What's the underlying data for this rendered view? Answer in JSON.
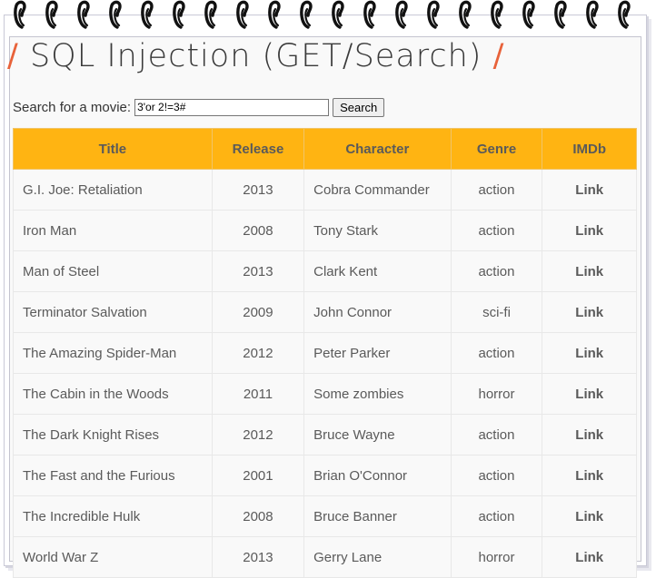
{
  "page": {
    "title_prefix": "/",
    "title_text": "SQL Injection (GET/Search)",
    "title_suffix": "/"
  },
  "search": {
    "label": "Search for a movie:",
    "value": "3'or 2!=3#",
    "button_label": "Search"
  },
  "table": {
    "headers": [
      "Title",
      "Release",
      "Character",
      "Genre",
      "IMDb"
    ],
    "rows": [
      {
        "title": "G.I. Joe: Retaliation",
        "release": "2013",
        "character": "Cobra Commander",
        "genre": "action",
        "imdb": "Link"
      },
      {
        "title": "Iron Man",
        "release": "2008",
        "character": "Tony Stark",
        "genre": "action",
        "imdb": "Link"
      },
      {
        "title": "Man of Steel",
        "release": "2013",
        "character": "Clark Kent",
        "genre": "action",
        "imdb": "Link"
      },
      {
        "title": "Terminator Salvation",
        "release": "2009",
        "character": "John Connor",
        "genre": "sci-fi",
        "imdb": "Link"
      },
      {
        "title": "The Amazing Spider-Man",
        "release": "2012",
        "character": "Peter Parker",
        "genre": "action",
        "imdb": "Link"
      },
      {
        "title": "The Cabin in the Woods",
        "release": "2011",
        "character": "Some zombies",
        "genre": "horror",
        "imdb": "Link"
      },
      {
        "title": "The Dark Knight Rises",
        "release": "2012",
        "character": "Bruce Wayne",
        "genre": "action",
        "imdb": "Link"
      },
      {
        "title": "The Fast and the Furious",
        "release": "2001",
        "character": "Brian O'Connor",
        "genre": "action",
        "imdb": "Link"
      },
      {
        "title": "The Incredible Hulk",
        "release": "2008",
        "character": "Bruce Banner",
        "genre": "action",
        "imdb": "Link"
      },
      {
        "title": "World War Z",
        "release": "2013",
        "character": "Gerry Lane",
        "genre": "horror",
        "imdb": "Link"
      }
    ]
  },
  "colors": {
    "header_bg": "#ffb412",
    "slash_accent": "#e8623a"
  },
  "icons": {
    "binding": "spiral-coil-icon"
  }
}
